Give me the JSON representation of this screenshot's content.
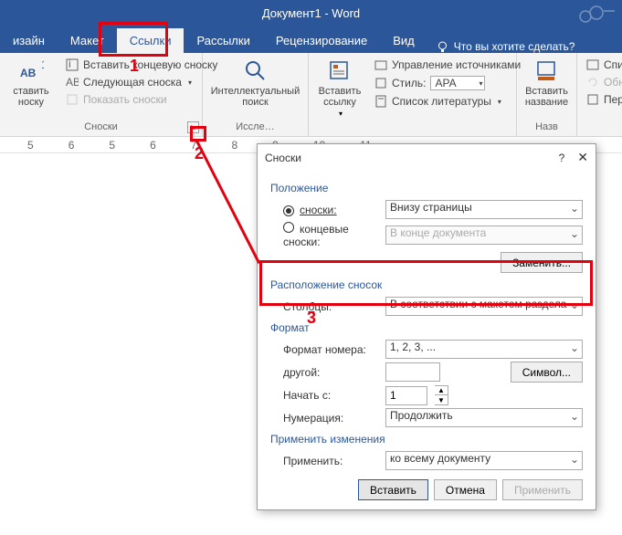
{
  "window": {
    "title": "Документ1 - Word"
  },
  "tabs": {
    "design": "изайн",
    "layout": "Макет",
    "references": "Ссылки",
    "mailings": "Рассылки",
    "review": "Рецензирование",
    "view": "Вид",
    "tell_me": "Что вы хотите сделать?"
  },
  "ribbon": {
    "footnotes": {
      "insert_footnote": "ставить\nноску",
      "insert_endnote": "Вставить концевую сноску",
      "next_footnote": "Следующая сноска",
      "show_notes": "Показать сноски",
      "group_label": "Сноски"
    },
    "research": {
      "smart_lookup": "Интеллектуальный\nпоиск",
      "group_label": "Иссле…"
    },
    "citations": {
      "insert_citation": "Вставить\nссылку",
      "manage_sources": "Управление источниками",
      "style_label": "Стиль:",
      "style_value": "APA",
      "bibliography": "Список литературы"
    },
    "captions": {
      "insert_caption": "Вставить\nназвание",
      "group_label": "Назв"
    },
    "index": {
      "mark_entry": "Спис",
      "update_index": "Обн",
      "cross_ref": "Пер"
    }
  },
  "ruler": [
    "5",
    "6",
    "5",
    "6",
    "7",
    "8",
    "9",
    "10",
    "11"
  ],
  "dialog": {
    "title": "Сноски",
    "position_title": "Положение",
    "footnotes_radio": "сноски:",
    "footnotes_value": "Внизу страницы",
    "endnotes_radio": "концевые сноски:",
    "endnotes_value": "В конце документа",
    "convert_btn": "Заменить...",
    "layout_title": "Расположение сносок",
    "columns_label": "Столбцы:",
    "columns_value": "В соответствии с макетом раздела",
    "format_title": "Формат",
    "number_format_label": "Формат номера:",
    "number_format_value": "1, 2, 3, ...",
    "custom_label": "другой:",
    "symbol_btn": "Символ...",
    "start_label": "Начать с:",
    "start_value": "1",
    "numbering_label": "Нумерация:",
    "numbering_value": "Продолжить",
    "apply_changes_title": "Применить изменения",
    "apply_to_label": "Применить:",
    "apply_to_value": "ко всему документу",
    "insert_btn": "Вставить",
    "cancel_btn": "Отмена",
    "apply_btn": "Применить"
  },
  "annotations": {
    "n1": "1",
    "n2": "2",
    "n3": "3"
  }
}
